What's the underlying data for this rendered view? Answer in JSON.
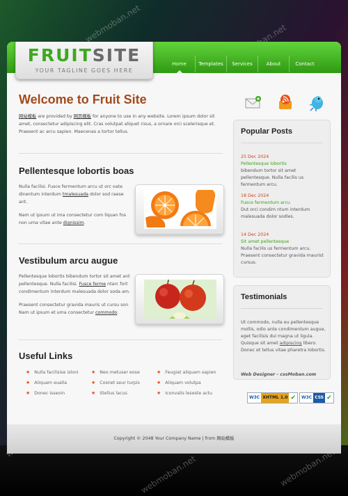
{
  "logo": {
    "word1": "FRUIT",
    "word2": "SITE",
    "tagline": "YOUR TAGLINE GOES HERE"
  },
  "nav": [
    "Home",
    "Templates",
    "Services",
    "About",
    "Contact"
  ],
  "welcome": {
    "title": "Welcome to Fruit Site",
    "link1": "网站模板",
    "text1": " are provided by ",
    "link2": "网页模板",
    "text2": " for anyone to use in any website. Lorem ipsum dolor sit amet, consectetur adipiscing elit. Cras volutpat aliquet risus, a ornare orci scelerisque et. Praesent ac arcu sapien. Maecenas a tortor tellus."
  },
  "section1": {
    "title": "Pellentesque lobortis boas",
    "p1a": "Nulla facilisi. Fusce fermentum arcu ut orc oate dinentum interdum ",
    "p1link": "tmalesuada",
    "p1b": " dolor sod raese ant.",
    "p2a": "Nam ut ipsum ut ima consectetur com liquan fos non uma vitae ante ",
    "p2link": "dignissim",
    "p2b": "."
  },
  "section2": {
    "title": "Vestibulum arcu augue",
    "p1a": "Pellentesque lobortis bibendum tortor sit amet ant pellentesque. Nulla facilisi. ",
    "p1link": "Fusce ferme",
    "p1b": " ntarc fort condimentum interdum malesuada dolor soda am.",
    "p2a": "Praesent consectetur gravida mauris ut cursu son Nam ut ipsum et uma consectetur ",
    "p2link": "commodo",
    "p2b": "."
  },
  "useful_links": {
    "title": "Useful Links",
    "col1": [
      "Nulla facilisise isloni",
      "Aliquam eualla",
      "Donec isseoin"
    ],
    "col2": [
      "Neo metuser eose",
      "Cosnet seur turpis",
      "Stellus lacus"
    ],
    "col3": [
      "Feugiat aliquam sapien",
      "Aliquam volutpa",
      "Iconvalis leseste actu"
    ]
  },
  "popular_posts": {
    "title": "Popular Posts",
    "posts": [
      {
        "date": "25 Dec 2024",
        "title": "Pellentesque lobortis",
        "body": "bibendum tortor sit amet pellentesque. Nulla facilis us fermentum arcu."
      },
      {
        "date": "18 Dec 2024",
        "title": "Fusce fermentum arcu",
        "body": "Dut orci condim ntum interdum malesuada dolor sodles."
      },
      {
        "date": "14 Dec 2024",
        "title": "Sit amet pellentesque",
        "body": "Nulla facilis us fermentum arcu. Praesent consectetur gravida maurist cursus."
      }
    ]
  },
  "testimonials": {
    "title": "Testimonials",
    "text_a": "Ut commodo, nulla eu pellentesque mollis, odio ante condimentum augue, eget facilisis dui magna ut ligula. Quisque sit amet ",
    "link": "adipiscing",
    "text_b": " libero. Donec et tellus vitae pharetra lobortis.",
    "author": "Web Designer - cssMoban.com"
  },
  "badges": {
    "w3c": "W3C",
    "xhtml": "XHTML 1.0",
    "css": "CSS"
  },
  "footer": "Copyright © 2048 Your Company Name | from 网站模板",
  "watermark": "webmoban.net",
  "colors": {
    "green": "#3ea81f",
    "orange_title": "#a24a1c",
    "date_red": "#c9461c",
    "star": "#e34b1d"
  },
  "icons": [
    "mail-icon",
    "rss-icon",
    "twitter-bird-icon"
  ]
}
